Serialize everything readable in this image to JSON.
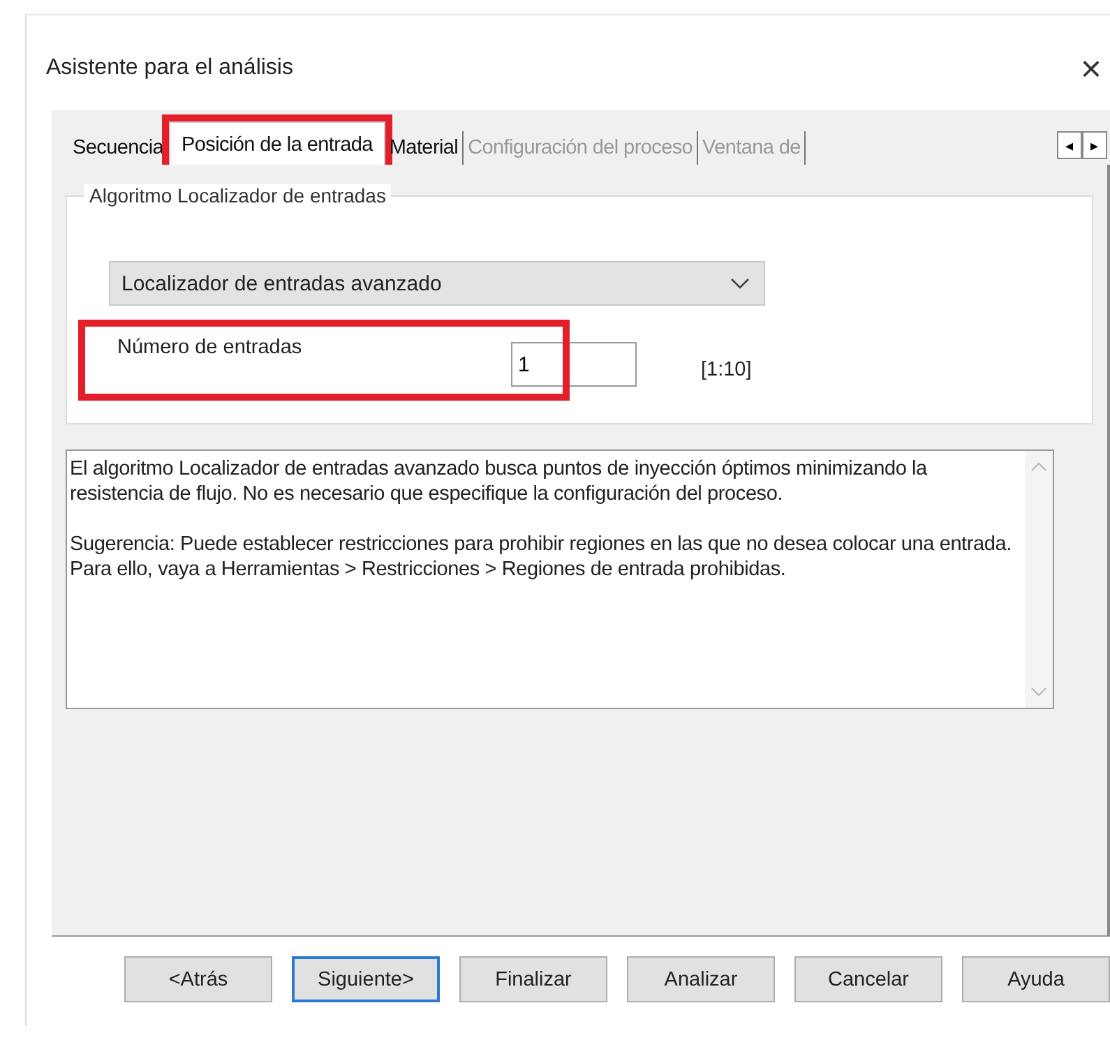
{
  "window": {
    "title": "Asistente para el análisis",
    "close": "×"
  },
  "tabs": [
    {
      "label": "Secuencia",
      "selected": false,
      "disabled": false,
      "highlighted": false
    },
    {
      "label": "Posición de la entrada",
      "selected": true,
      "disabled": false,
      "highlighted": true
    },
    {
      "label": "Material",
      "selected": false,
      "disabled": false,
      "highlighted": false
    },
    {
      "label": "Configuración del proceso",
      "selected": false,
      "disabled": true,
      "highlighted": false
    },
    {
      "label": "Ventana de",
      "selected": false,
      "disabled": true,
      "highlighted": false
    }
  ],
  "tab_scroll": {
    "left": "◂",
    "right": "▸"
  },
  "group": {
    "title": "Algoritmo Localizador de entradas",
    "dropdown": {
      "value": "Localizador de entradas avanzado"
    },
    "field": {
      "label": "Número de entradas",
      "value": "1",
      "range": "[1:10]",
      "highlighted": true
    }
  },
  "description": [
    "El algoritmo Localizador de entradas avanzado busca puntos de inyección óptimos minimizando la resistencia de flujo. No es necesario que especifique la configuración del proceso.",
    " Sugerencia: Puede establecer restricciones para prohibir regiones en las que no desea colocar una entrada. Para ello, vaya a Herramientas > Restricciones > Regiones de entrada prohibidas."
  ],
  "buttons": [
    {
      "label": "<Atrás",
      "default": false
    },
    {
      "label": "Siguiente>",
      "default": true
    },
    {
      "label": "Finalizar",
      "default": false
    },
    {
      "label": "Analizar",
      "default": false
    },
    {
      "label": "Cancelar",
      "default": false
    },
    {
      "label": "Ayuda",
      "default": false
    }
  ]
}
